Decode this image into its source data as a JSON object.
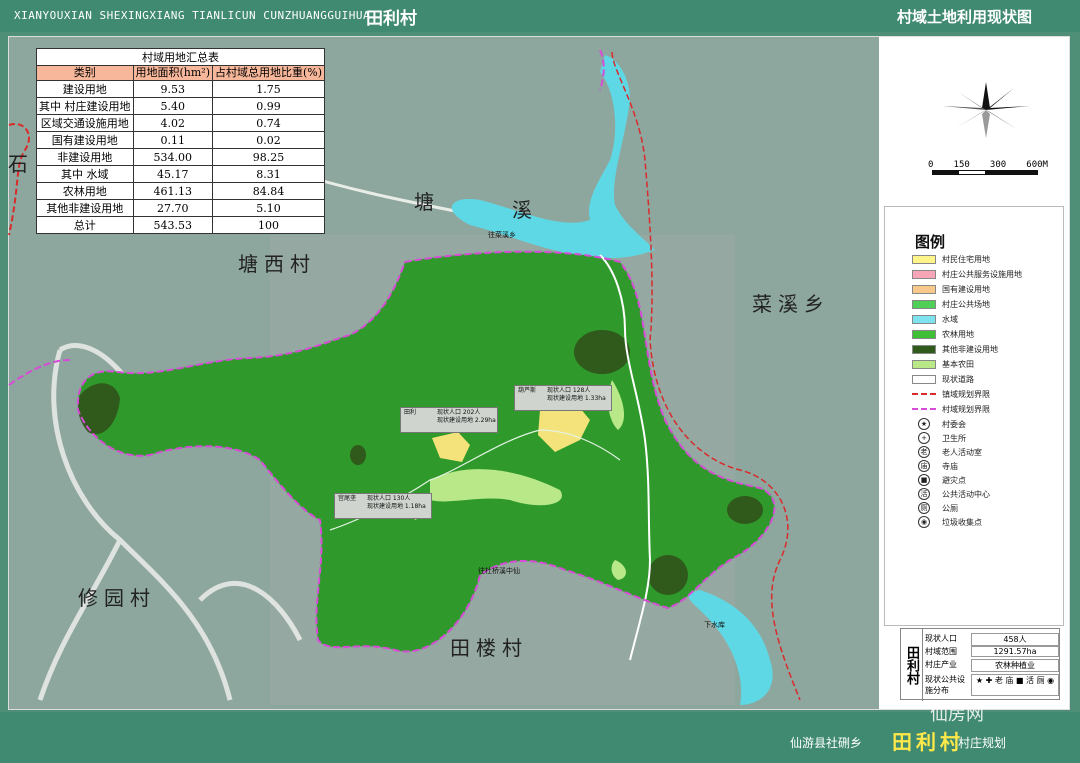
{
  "header": {
    "pinyin": "XIANYOUXIAN SHEXINGXIANG TIANLICUN CUNZHUANGGUIHUA",
    "village": "田利村",
    "map_title": "村域土地利用现状图"
  },
  "summary_table": {
    "caption": "村域用地汇总表",
    "headers": [
      "类别",
      "用地面积(hm²)",
      "占村域总用地比重(%)"
    ],
    "group_label": "其中",
    "rows": [
      {
        "category": "建设用地",
        "area": "9.53",
        "share": "1.75"
      },
      {
        "category": "村庄建设用地",
        "area": "5.40",
        "share": "0.99"
      },
      {
        "category": "区域交通设施用地",
        "area": "4.02",
        "share": "0.74"
      },
      {
        "category": "国有建设用地",
        "area": "0.11",
        "share": "0.02"
      },
      {
        "category": "非建设用地",
        "area": "534.00",
        "share": "98.25"
      },
      {
        "category": "水域",
        "area": "45.17",
        "share": "8.31"
      },
      {
        "category": "农林用地",
        "area": "461.13",
        "share": "84.84"
      },
      {
        "category": "其他非建设用地",
        "area": "27.70",
        "share": "5.10"
      },
      {
        "category": "总计",
        "area": "543.53",
        "share": "100"
      }
    ]
  },
  "map_places": {
    "shi": "石",
    "tang": "塘",
    "xi": "溪",
    "tangxi_village": "塘西村",
    "caixi_town": "菜溪乡",
    "xiuyuan_village": "修园村",
    "tianlou_village": "田楼村"
  },
  "map_labels": {
    "road_label_1": "往菜溪乡",
    "road_label_2": "往杜桥溪中仙",
    "xiashuiku": "下水库",
    "callouts": [
      {
        "name": "田利",
        "line1": "现状人口    202人",
        "line2": "现状建设用地   2.29ha"
      },
      {
        "name": "葫芦斯",
        "line1": "现状人口    128人",
        "line2": "现状建设用地   1.33ha"
      },
      {
        "name": "宫尾垄",
        "line1": "现状人口    130人",
        "line2": "现状建设用地   1.18ha"
      }
    ]
  },
  "scale": {
    "ticks": [
      "0",
      "150",
      "300",
      "600M"
    ]
  },
  "legend": {
    "title": "图例",
    "swatches": [
      {
        "label": "村民住宅用地",
        "color": "#fff48a"
      },
      {
        "label": "村庄公共服务设施用地",
        "color": "#f7a6b8"
      },
      {
        "label": "国有建设用地",
        "color": "#f8c98a"
      },
      {
        "label": "村庄公共场地",
        "color": "#4fcf56"
      },
      {
        "label": "水域",
        "color": "#7fe3ef"
      },
      {
        "label": "农林用地",
        "color": "#3fbf35"
      },
      {
        "label": "其他非建设用地",
        "color": "#2f5a1c"
      },
      {
        "label": "基本农田",
        "color": "#b9e889"
      },
      {
        "label": "现状道路",
        "color": "#ffffff"
      },
      {
        "label": "镇域规划界限",
        "color": "#d92b2b"
      },
      {
        "label": "村域规划界限",
        "color": "#d64cd6"
      }
    ],
    "symbols": [
      {
        "label": "村委会",
        "glyph": "★"
      },
      {
        "label": "卫生所",
        "glyph": "+"
      },
      {
        "label": "老人活动室",
        "glyph": "老"
      },
      {
        "label": "寺庙",
        "glyph": "庙"
      },
      {
        "label": "避灾点",
        "glyph": "■"
      },
      {
        "label": "公共活动中心",
        "glyph": "活"
      },
      {
        "label": "公厕",
        "glyph": "厕"
      },
      {
        "label": "垃圾收集点",
        "glyph": "◉"
      }
    ]
  },
  "info_box": {
    "side_label": "田利村",
    "rows": [
      {
        "key": "现状人口",
        "value": "458人"
      },
      {
        "key": "村域范围",
        "value": "1291.57ha"
      },
      {
        "key": "村庄产业",
        "value": "农林种植业"
      },
      {
        "key": "现状公共设施分布",
        "value": "★ ✚ 老 庙 ■ 活 厕 ◉"
      }
    ]
  },
  "footer": {
    "county": "仙游县社硎乡",
    "village": "田利村",
    "plan": "村庄规划"
  },
  "watermark": "仙房网",
  "colors": {
    "band": "#3f8a70",
    "terrain": "#8ea79e",
    "village_land": "#2f9a2b",
    "water": "#5fd8e6",
    "boundary_town": "#d92b2b",
    "boundary_village": "#d64cd6"
  }
}
